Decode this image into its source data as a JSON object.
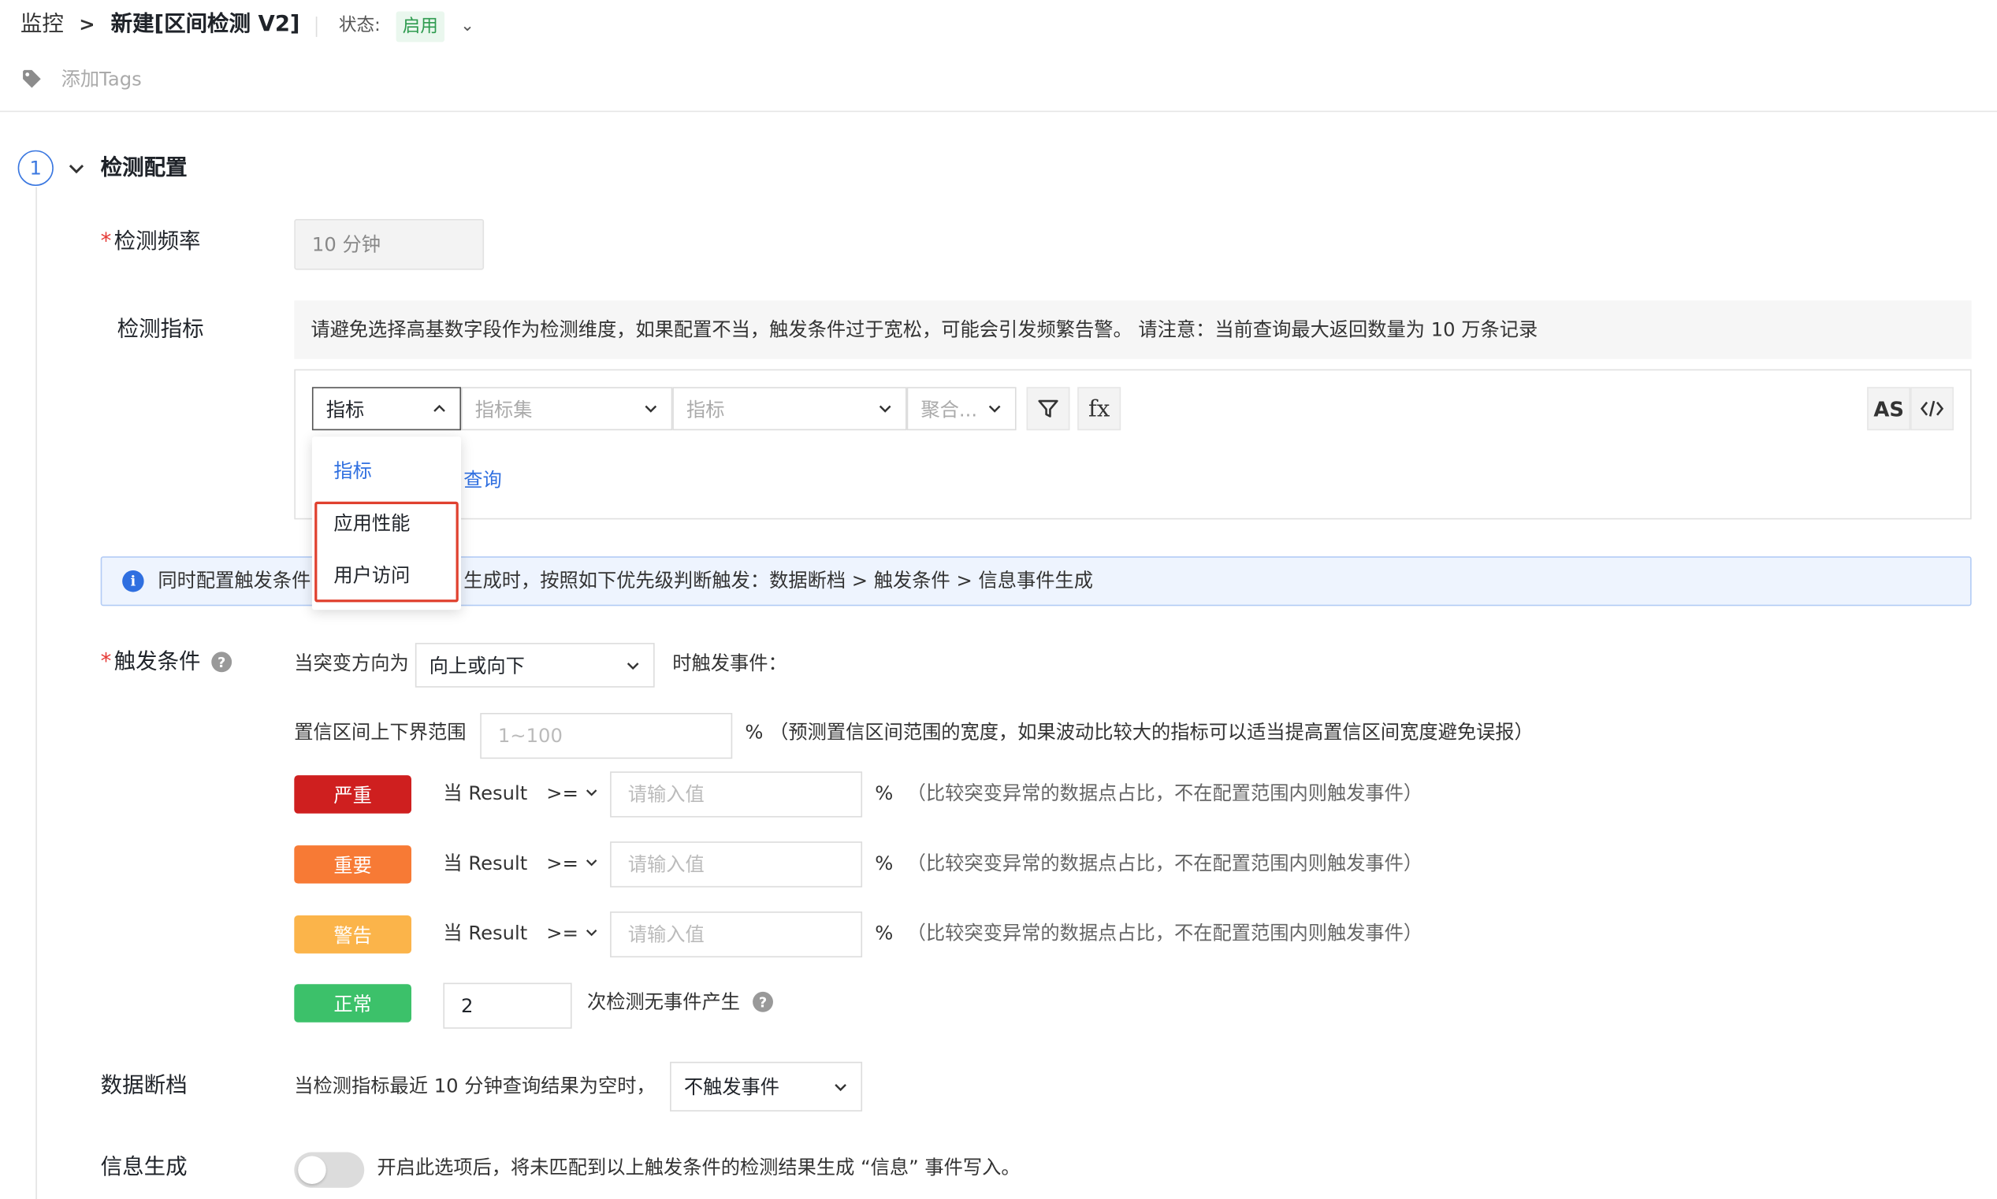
{
  "header": {
    "breadcrumb_root": "监控",
    "breadcrumb_sep": ">",
    "title": "新建[区间检测 V2]",
    "status_label": "状态:",
    "status_value": "启用",
    "tags_label": "添加Tags"
  },
  "section": {
    "step_number": "1",
    "title": "检测配置"
  },
  "frequency": {
    "label": "检测频率",
    "value": "10 分钟"
  },
  "metric": {
    "label": "检测指标",
    "notice": "请避免选择高基数字段作为检测维度，如果配置不当，触发条件过于宽松，可能会引发频繁告警。 请注意：当前查询最大返回数量为 10 万条记录",
    "source_select": "指标",
    "metric_set_placeholder": "指标集",
    "metric_placeholder": "指标",
    "aggregate_placeholder": "聚合...",
    "fx_label": "fx",
    "as_label": "AS",
    "query_link": "查询",
    "dropdown_options": [
      "指标",
      "应用性能",
      "用户访问"
    ]
  },
  "info_bar": {
    "text_left": "同时配置触发条件",
    "text_right": "生成时，按照如下优先级判断触发：数据断档 > 触发条件 > 信息事件生成"
  },
  "trigger": {
    "label": "触发条件",
    "direction_prefix": "当突变方向为",
    "direction_value": "向上或向下",
    "direction_suffix": "时触发事件：",
    "range_label": "置信区间上下界范围",
    "range_placeholder": "1~100",
    "range_hint": "%  （预测置信区间范围的宽度，如果波动比较大的指标可以适当提高置信区间宽度避免误报）",
    "levels": [
      {
        "name": "严重",
        "color": "#cf1f1f",
        "cond": "当 Result",
        "op": ">=",
        "placeholder": "请输入值",
        "unit": "%",
        "hint": "（比较突变异常的数据点占比，不在配置范围内则触发事件）"
      },
      {
        "name": "重要",
        "color": "#f77a35",
        "cond": "当 Result",
        "op": ">=",
        "placeholder": "请输入值",
        "unit": "%",
        "hint": "（比较突变异常的数据点占比，不在配置范围内则触发事件）"
      },
      {
        "name": "警告",
        "color": "#fbb44a",
        "cond": "当 Result",
        "op": ">=",
        "placeholder": "请输入值",
        "unit": "%",
        "hint": "（比较突变异常的数据点占比，不在配置范围内则触发事件）"
      }
    ],
    "normal_name": "正常",
    "normal_color": "#3cc16a",
    "normal_value": "2",
    "normal_suffix": "次检测无事件产生"
  },
  "nodata": {
    "label": "数据断档",
    "text": "当检测指标最近 10 分钟查询结果为空时，",
    "select_value": "不触发事件"
  },
  "infogen": {
    "label": "信息生成",
    "enabled": false,
    "text": "开启此选项后，将未匹配到以上触发条件的检测结果生成 “信息” 事件写入。"
  }
}
